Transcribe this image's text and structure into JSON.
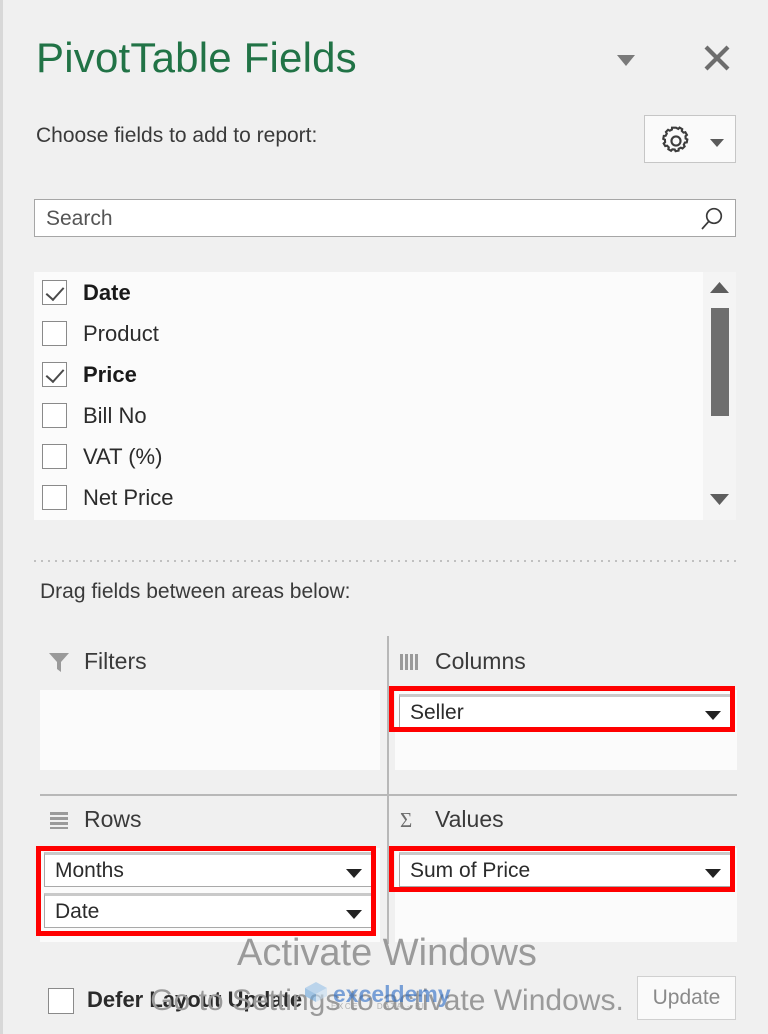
{
  "panel": {
    "title": "PivotTable Fields",
    "choose_label": "Choose fields to add to report:",
    "drag_label": "Drag fields between areas below:",
    "caret_icon": "chevron-down-icon",
    "close_icon": "close-icon",
    "gear_icon": "gear-icon",
    "gear_caret_icon": "chevron-down-icon"
  },
  "search": {
    "placeholder": "Search",
    "value": "",
    "icon": "search-icon"
  },
  "fields": {
    "items": [
      {
        "label": "Date",
        "checked": true,
        "bold": true
      },
      {
        "label": "Product",
        "checked": false,
        "bold": false
      },
      {
        "label": "Price",
        "checked": true,
        "bold": true
      },
      {
        "label": "Bill No",
        "checked": false,
        "bold": false
      },
      {
        "label": "VAT (%)",
        "checked": false,
        "bold": false
      },
      {
        "label": "Net Price",
        "checked": false,
        "bold": false
      }
    ],
    "scroll_up_icon": "triangle-up-icon",
    "scroll_down_icon": "triangle-down-icon"
  },
  "areas": {
    "filters": {
      "label": "Filters",
      "icon": "funnel-icon",
      "pills": []
    },
    "columns": {
      "label": "Columns",
      "icon": "columns-icon",
      "pills": [
        {
          "label": "Seller",
          "highlighted": true,
          "caret_icon": "caret-down-icon"
        }
      ]
    },
    "rows": {
      "label": "Rows",
      "icon": "rows-icon",
      "pills": [
        {
          "label": "Months",
          "highlighted": true,
          "caret_icon": "caret-down-icon"
        },
        {
          "label": "Date",
          "highlighted": true,
          "caret_icon": "caret-down-icon"
        }
      ]
    },
    "values": {
      "label": "Values",
      "icon": "sigma-icon",
      "pills": [
        {
          "label": "Sum of Price",
          "highlighted": true,
          "caret_icon": "caret-down-icon"
        }
      ]
    }
  },
  "footer": {
    "defer_label": "Defer Layout Update",
    "defer_checked": false,
    "update_label": "Update"
  },
  "watermark": {
    "activate_title": "Activate Windows",
    "activate_sub": "Go to Settings to activate Windows.",
    "logo_text": "exceldemy",
    "logo_sub": "EXCEL · DATA · BI"
  },
  "colors": {
    "title_green": "#217346",
    "highlight_red": "#ff0000",
    "panel_bg": "#f0f0f0",
    "logo_blue": "#2f6fc7"
  }
}
